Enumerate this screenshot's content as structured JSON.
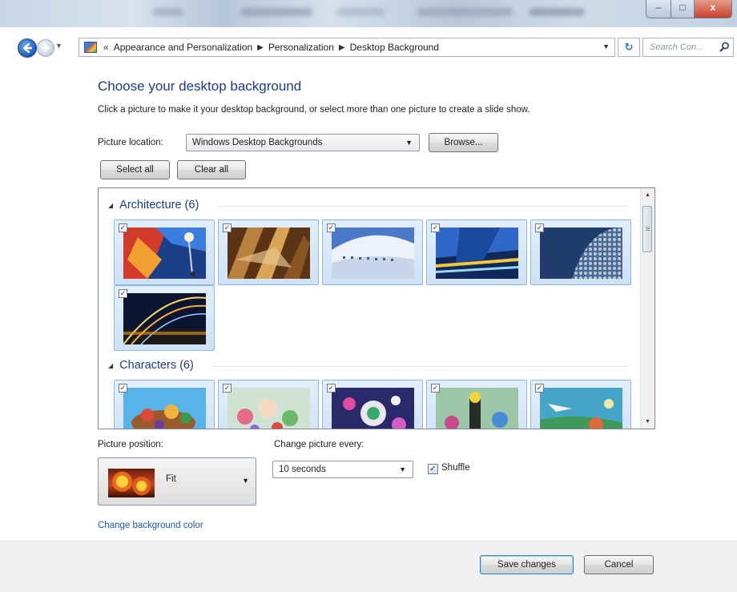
{
  "window": {
    "minimize_glyph": "–",
    "maximize_glyph": "□",
    "close_glyph": "x"
  },
  "nav": {
    "breadcrumb_overflow": "«",
    "breadcrumbs": [
      "Appearance and Personalization",
      "Personalization",
      "Desktop Background"
    ],
    "search_placeholder": "Search Con..."
  },
  "page": {
    "title": "Choose your desktop background",
    "instructions": "Click a picture to make it your desktop background, or select more than one picture to create a slide show."
  },
  "picture_location": {
    "label": "Picture location:",
    "value": "Windows Desktop Backgrounds",
    "browse_label": "Browse..."
  },
  "selection": {
    "select_all_label": "Select all",
    "clear_all_label": "Clear all"
  },
  "groups": [
    {
      "title": "Architecture (6)",
      "items": [
        {
          "name": "architecture-1",
          "checked": true
        },
        {
          "name": "architecture-2",
          "checked": true
        },
        {
          "name": "architecture-3",
          "checked": true
        },
        {
          "name": "architecture-4",
          "checked": true
        },
        {
          "name": "architecture-5",
          "checked": true
        },
        {
          "name": "architecture-6",
          "checked": true
        }
      ]
    },
    {
      "title": "Characters (6)",
      "items": [
        {
          "name": "characters-1",
          "checked": true
        },
        {
          "name": "characters-2",
          "checked": true
        },
        {
          "name": "characters-3",
          "checked": true
        },
        {
          "name": "characters-4",
          "checked": true
        },
        {
          "name": "characters-5",
          "checked": true
        }
      ]
    }
  ],
  "picture_position": {
    "label": "Picture position:",
    "value": "Fit"
  },
  "interval": {
    "label": "Change picture every:",
    "value": "10 seconds"
  },
  "shuffle": {
    "label": "Shuffle",
    "checked": true
  },
  "change_color_link": "Change background color",
  "footer": {
    "save_label": "Save changes",
    "cancel_label": "Cancel"
  },
  "colors": {
    "heading": "#1a3c8c",
    "link": "#1f56b0",
    "selection_bg": "#cfe1f6"
  }
}
